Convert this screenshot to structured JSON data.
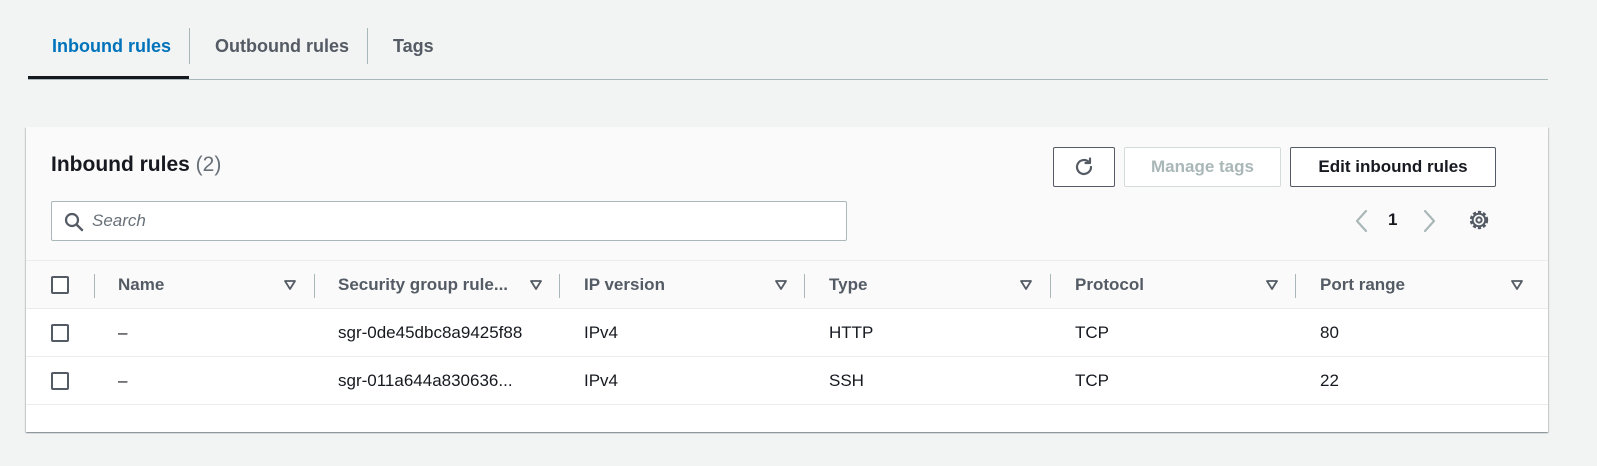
{
  "tabs": [
    {
      "label": "Inbound rules",
      "active": true
    },
    {
      "label": "Outbound rules",
      "active": false
    },
    {
      "label": "Tags",
      "active": false
    }
  ],
  "panel": {
    "title": "Inbound rules",
    "count": "(2)",
    "buttons": {
      "refresh_icon": "refresh-icon",
      "manage_tags": "Manage tags",
      "edit_inbound": "Edit inbound rules"
    },
    "search": {
      "placeholder": "Search",
      "value": ""
    },
    "pagination": {
      "current_page": "1"
    }
  },
  "table": {
    "columns": [
      "Name",
      "Security group rule...",
      "IP version",
      "Type",
      "Protocol",
      "Port range"
    ],
    "rows": [
      {
        "name": "–",
        "rule_id": "sgr-0de45dbc8a9425f88",
        "ip_version": "IPv4",
        "type": "HTTP",
        "protocol": "TCP",
        "port_range": "80"
      },
      {
        "name": "–",
        "rule_id": "sgr-011a644a830636...",
        "ip_version": "IPv4",
        "type": "SSH",
        "protocol": "TCP",
        "port_range": "22"
      }
    ]
  },
  "colors": {
    "accent": "#0073bb",
    "text": "#16191f",
    "muted": "#545b64",
    "disabled": "#aab7b8"
  }
}
